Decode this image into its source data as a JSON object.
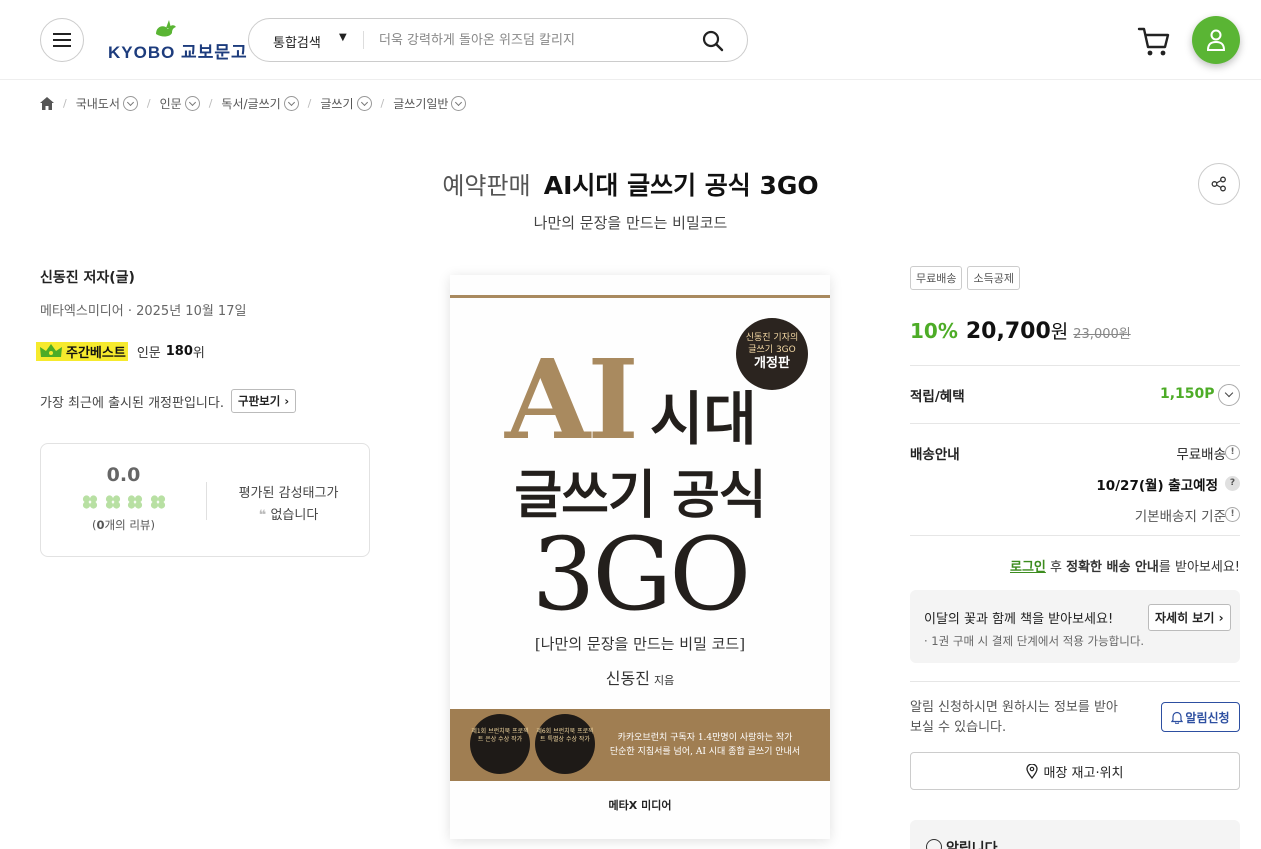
{
  "header": {
    "logo_text": "KYOBO 교보문고",
    "search_type": "통합검색",
    "search_placeholder": "더욱 강력하게 돌아온 위즈덤 칼리지"
  },
  "breadcrumb": [
    "국내도서",
    "인문",
    "독서/글쓰기",
    "글쓰기",
    "글쓰기일반"
  ],
  "title": {
    "pre_tag": "예약판매",
    "main": "AI시대 글쓰기 공식 3GO",
    "subtitle": "나만의 문장을 만드는 비밀코드"
  },
  "left": {
    "author": "신동진 저자(글)",
    "pubinfo": "메타엑스미디어 · 2025년 10월 17일",
    "best_badge": "주간베스트",
    "best_category": "인문",
    "best_rank": "180",
    "best_unit": "위",
    "edition_text": "가장 최근에 출시된 개정판입니다.",
    "edition_button": "구판보기",
    "review": {
      "score": "0.0",
      "count_prefix": "(",
      "count": "0",
      "count_suffix": "개의 리뷰)",
      "tag_line1": "평가된 감성태그가",
      "tag_line2": "없습니다"
    }
  },
  "cover": {
    "seal_line1": "신동진 기자의",
    "seal_line2": "글쓰기 3GO",
    "seal_line3": "개정판",
    "ai": "AI",
    "sidae": "시대",
    "line2": "글쓰기 공식",
    "line3": "3GO",
    "sub": "[나만의 문장을 만드는 비밀 코드]",
    "author": "신동진",
    "author_suffix": "지음",
    "award1": "제1회 브런치북 프로젝트 은상 수상 작가",
    "award2": "제6회 브런치북 프로젝트 특별상 수상 작가",
    "band_line1": "카카오브런치 구독자 1.4만명이 사랑하는 작가",
    "band_line2": "단순한 지침서를 넘어, AI 시대 종합 글쓰기 안내서",
    "publisher": "메타X 미디어"
  },
  "right": {
    "badges": [
      "무료배송",
      "소득공제"
    ],
    "discount": "10%",
    "price": "20,700",
    "won": "원",
    "original_price": "23,000원",
    "points_label": "적립/혜택",
    "points_value": "1,150P",
    "delivery_label": "배송안내",
    "delivery_free": "무료배송",
    "ship_date": "10/27(월) 출고예정",
    "ship_basis": "기본배송지 기준",
    "login_link": "로그인",
    "login_mid": " 후 ",
    "login_bold": "정확한 배송 안내",
    "login_end": "를 받아보세요!",
    "flower_title": "이달의 꽃과 함께 책을 받아보세요!",
    "flower_button": "자세히 보기",
    "flower_note": "· 1권 구매 시 결제 단계에서 적용 가능합니다.",
    "alert_text": "알림 신청하시면 원하시는 정보를 받아 보실 수 있습니다.",
    "alert_button": "알림신청",
    "store_button": "매장 재고·위치",
    "notice_title": "알립니다"
  },
  "colors": {
    "brand_green": "#5ab534",
    "discount_green": "#4dac27",
    "best_yellow": "#f6ea2d",
    "navy": "#1d3c7d",
    "cover_gold": "#a98a5f"
  }
}
